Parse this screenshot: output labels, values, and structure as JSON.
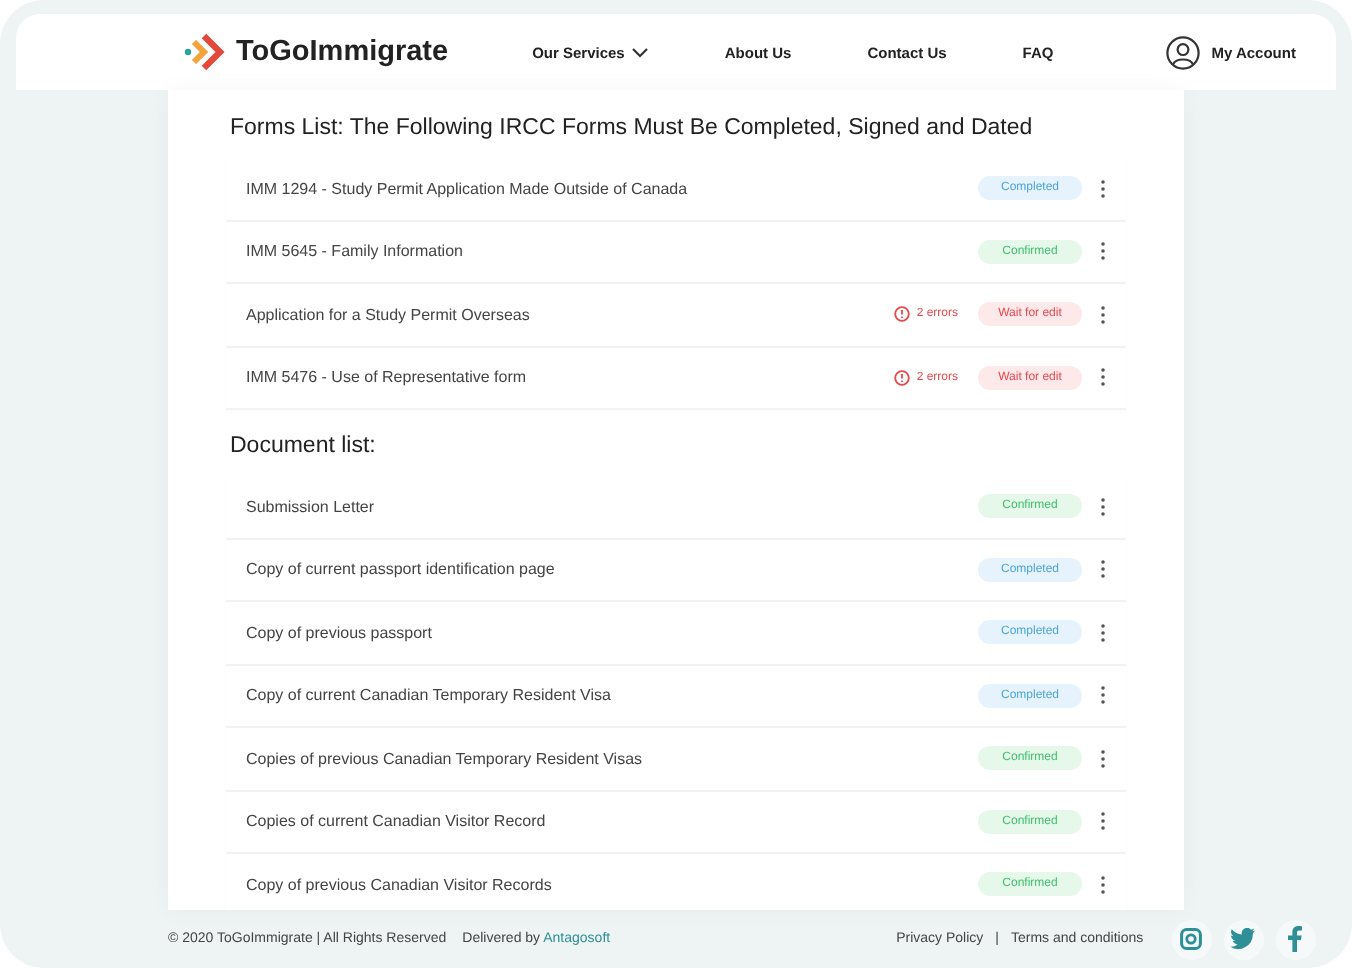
{
  "header": {
    "logo": "ToGoImmigrate",
    "nav": [
      {
        "label": "Our Services",
        "dropdown": true
      },
      {
        "label": "About Us",
        "dropdown": false
      },
      {
        "label": "Contact Us",
        "dropdown": false
      },
      {
        "label": "FAQ",
        "dropdown": false
      }
    ],
    "account": "My Account"
  },
  "sections": [
    {
      "title": "Forms List: The Following IRCC Forms Must Be Completed, Signed and Dated",
      "items": [
        {
          "name": "IMM 1294 - Study Permit Application Made Outside of Canada",
          "status": {
            "kind": "completed",
            "label": "Completed"
          }
        },
        {
          "name": "IMM 5645 - Family Information",
          "status": {
            "kind": "confirmed",
            "label": "Confirmed"
          }
        },
        {
          "name": "Application for a Study Permit Overseas",
          "errors": "2 errors",
          "status": {
            "kind": "wait",
            "label": "Wait for edit"
          }
        },
        {
          "name": "IMM 5476 - Use of Representative form",
          "errors": "2 errors",
          "status": {
            "kind": "wait",
            "label": "Wait for edit"
          }
        }
      ]
    },
    {
      "title": "Document list:",
      "items": [
        {
          "name": "Submission Letter",
          "status": {
            "kind": "confirmed",
            "label": "Confirmed"
          }
        },
        {
          "name": "Copy of current passport identification page",
          "status": {
            "kind": "completed",
            "label": "Completed"
          }
        },
        {
          "name": "Copy of previous passport",
          "status": {
            "kind": "completed",
            "label": "Completed"
          }
        },
        {
          "name": "Copy of current Canadian Temporary Resident Visa",
          "status": {
            "kind": "completed",
            "label": "Completed"
          }
        },
        {
          "name": "Copies of previous Canadian Temporary Resident Visas",
          "status": {
            "kind": "confirmed",
            "label": "Confirmed"
          }
        },
        {
          "name": "Copies of current Canadian Visitor Record",
          "status": {
            "kind": "confirmed",
            "label": "Confirmed"
          }
        },
        {
          "name": "Copy of previous Canadian Visitor Records",
          "status": {
            "kind": "confirmed",
            "label": "Confirmed"
          }
        }
      ]
    }
  ],
  "footer": {
    "copyright": "© 2020 ToGoImmigrate | All Rights Reserved",
    "delivered": "Delivered by",
    "delivered_link": "Antagosoft",
    "links": [
      "Privacy Policy",
      "Terms and conditions"
    ],
    "separator": "|"
  }
}
